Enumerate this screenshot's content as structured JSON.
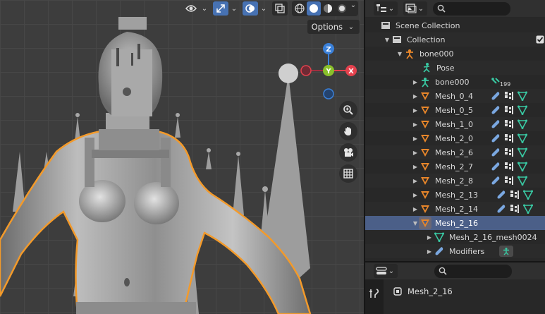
{
  "viewport": {
    "options_label": "Options",
    "header_icons": [
      "visibility-dropdown-icon",
      "gizmo-toggle-icon",
      "overlay-toggle-icon",
      "xray-toggle-icon",
      "wireframe-shading-icon",
      "solid-shading-icon",
      "material-shading-icon",
      "rendered-shading-icon"
    ],
    "gizmo": {
      "z_label": "Z",
      "y_label": "Y",
      "x_label": "X"
    },
    "tools": [
      "zoom-icon",
      "hand-pan-icon",
      "camera-icon",
      "grid-icon"
    ]
  },
  "outliner": {
    "search_placeholder": "",
    "rows": [
      {
        "label": "Scene Collection",
        "icon": "scene-collection-icon"
      },
      {
        "label": "Collection",
        "icon": "collection-icon",
        "checked": true
      },
      {
        "label": "bone000",
        "icon": "armature-icon"
      },
      {
        "label": "Pose",
        "icon": "pose-icon"
      },
      {
        "label": "bone000",
        "icon": "armature-data-icon",
        "badge": "199"
      },
      {
        "label": "Mesh_0_4",
        "icon": "mesh-object-icon"
      },
      {
        "label": "Mesh_0_5",
        "icon": "mesh-object-icon"
      },
      {
        "label": "Mesh_1_0",
        "icon": "mesh-object-icon"
      },
      {
        "label": "Mesh_2_0",
        "icon": "mesh-object-icon"
      },
      {
        "label": "Mesh_2_6",
        "icon": "mesh-object-icon"
      },
      {
        "label": "Mesh_2_7",
        "icon": "mesh-object-icon"
      },
      {
        "label": "Mesh_2_8",
        "icon": "mesh-object-icon"
      },
      {
        "label": "Mesh_2_13",
        "icon": "mesh-object-icon"
      },
      {
        "label": "Mesh_2_14",
        "icon": "mesh-object-icon"
      },
      {
        "label": "Mesh_2_16",
        "icon": "mesh-object-icon"
      },
      {
        "label": "Mesh_2_16_mesh0024",
        "icon": "mesh-data-icon"
      },
      {
        "label": "Modifiers",
        "icon": "modifier-icon"
      }
    ]
  },
  "properties": {
    "search_placeholder": "",
    "object_name": "Mesh_2_16"
  },
  "colors": {
    "accent": "#4772b3",
    "selection": "#4b5f88",
    "mesh_orange": "#e8862a",
    "vertex_group_green": "#39c9a3",
    "modifier_blue": "#7aa7e0",
    "axis_x": "#e4414d",
    "axis_y": "#8ac02a",
    "axis_z": "#3a80d9",
    "outline_orange": "#f39a2a"
  }
}
